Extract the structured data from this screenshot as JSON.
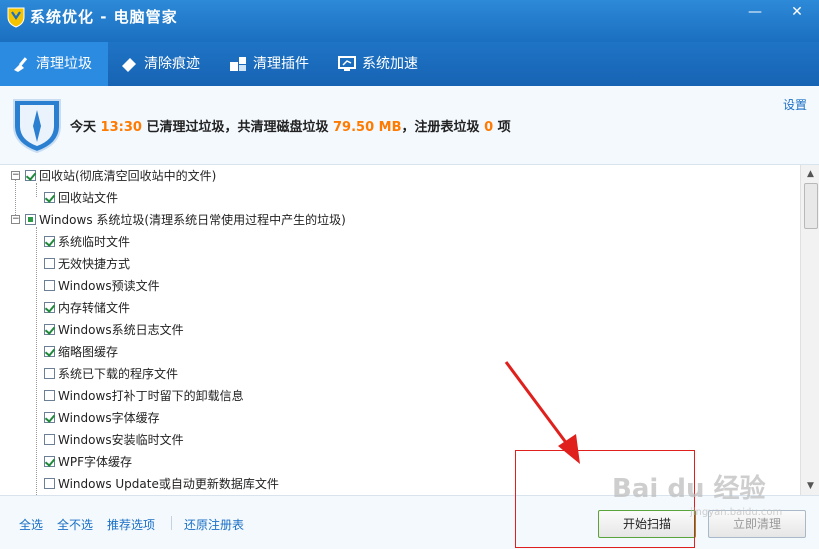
{
  "window": {
    "title": "系统优化 - 电脑管家",
    "minimize": "—",
    "close": "✕"
  },
  "tabs": [
    {
      "label": "清理垃圾",
      "active": true
    },
    {
      "label": "清除痕迹",
      "active": false
    },
    {
      "label": "清理插件",
      "active": false
    },
    {
      "label": "系统加速",
      "active": false
    }
  ],
  "header": {
    "prefix": "今天",
    "time": "13:30",
    "mid1": "已清理过垃圾，共清理磁盘垃圾",
    "disk_size": "79.50 MB",
    "mid2": "，注册表垃圾",
    "registry_count": "0",
    "suffix": "项",
    "settings_link": "设置",
    "highlight_color": "#ff7a00"
  },
  "tree": {
    "groups": [
      {
        "label": "回收站(彻底清空回收站中的文件)",
        "state": "checked",
        "items": [
          {
            "label": "回收站文件",
            "checked": true
          }
        ]
      },
      {
        "label": "Windows 系统垃圾(清理系统日常使用过程中产生的垃圾)",
        "state": "partial",
        "items": [
          {
            "label": "系统临时文件",
            "checked": true
          },
          {
            "label": "无效快捷方式",
            "checked": false
          },
          {
            "label": "Windows预读文件",
            "checked": false
          },
          {
            "label": "内存转储文件",
            "checked": true
          },
          {
            "label": "Windows系统日志文件",
            "checked": true
          },
          {
            "label": "缩略图缓存",
            "checked": true
          },
          {
            "label": "系统已下载的程序文件",
            "checked": false
          },
          {
            "label": "Windows打补丁时留下的卸载信息",
            "checked": false
          },
          {
            "label": "Windows字体缓存",
            "checked": true
          },
          {
            "label": "Windows安装临时文件",
            "checked": false
          },
          {
            "label": "WPF字体缓存",
            "checked": true
          },
          {
            "label": "Windows Update或自动更新数据库文件",
            "checked": false
          }
        ]
      }
    ]
  },
  "footer": {
    "select_all": "全选",
    "select_none": "全不选",
    "recommended": "推荐选项",
    "restore_registry": "还原注册表",
    "start_scan": "开始扫描",
    "clean_now": "立即清理"
  },
  "watermark": {
    "text": "Bai du 经验",
    "sub": "jingyan.baidu.com"
  },
  "colors": {
    "titlebar": "#1b6fc0",
    "active_tab": "#2b8be0",
    "link": "#1a6fc5",
    "annotation": "#e0201c"
  }
}
